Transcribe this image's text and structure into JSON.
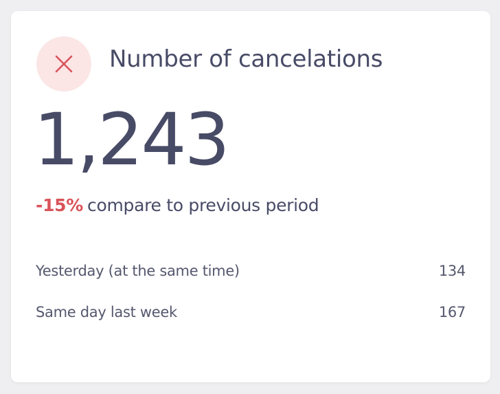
{
  "card": {
    "title": "Number of cancelations",
    "icon": "close-icon",
    "value": "1,243",
    "change_percent": "-15%",
    "change_text": "compare to previous period",
    "comparisons": [
      {
        "label": "Yesterday (at the same time)",
        "value": "134"
      },
      {
        "label": "Same day last week",
        "value": "167"
      }
    ]
  },
  "colors": {
    "accent_negative": "#d9535a",
    "icon_background": "#fbe5e5",
    "text_primary": "#484b66"
  }
}
